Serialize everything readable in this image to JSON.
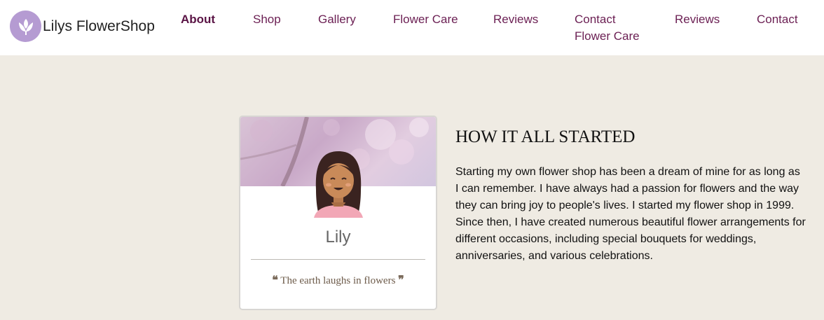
{
  "header": {
    "brand": "Lilys FlowerShop",
    "logo_icon": "tulip-icon",
    "nav": [
      {
        "label": "About",
        "active": true
      },
      {
        "label": "Shop"
      },
      {
        "label": "Gallery"
      },
      {
        "label": "Flower Care"
      },
      {
        "label": "Reviews"
      },
      {
        "label": "Contact"
      },
      {
        "label": "Flower Care"
      },
      {
        "label": "Reviews"
      },
      {
        "label": "Contact"
      }
    ]
  },
  "profile_card": {
    "name": "Lily",
    "quote": "The earth laughs in flowers",
    "open_quote_icon": "quote-left-icon",
    "close_quote_icon": "quote-right-icon"
  },
  "story": {
    "title": "HOW IT ALL STARTED",
    "body": "Starting my own flower shop has been a dream of mine for as long as I can remember. I have always had a passion for flowers and the way they can bring joy to people's lives. I started my flower shop in 1999. Since then, I have created numerous beautiful flower arrangements for different occasions, including special bouquets for weddings, anniversaries, and various celebrations."
  },
  "colors": {
    "nav_text": "#6b1f53",
    "page_bg": "#efebe3",
    "logo_purple": "#b59bd2"
  }
}
